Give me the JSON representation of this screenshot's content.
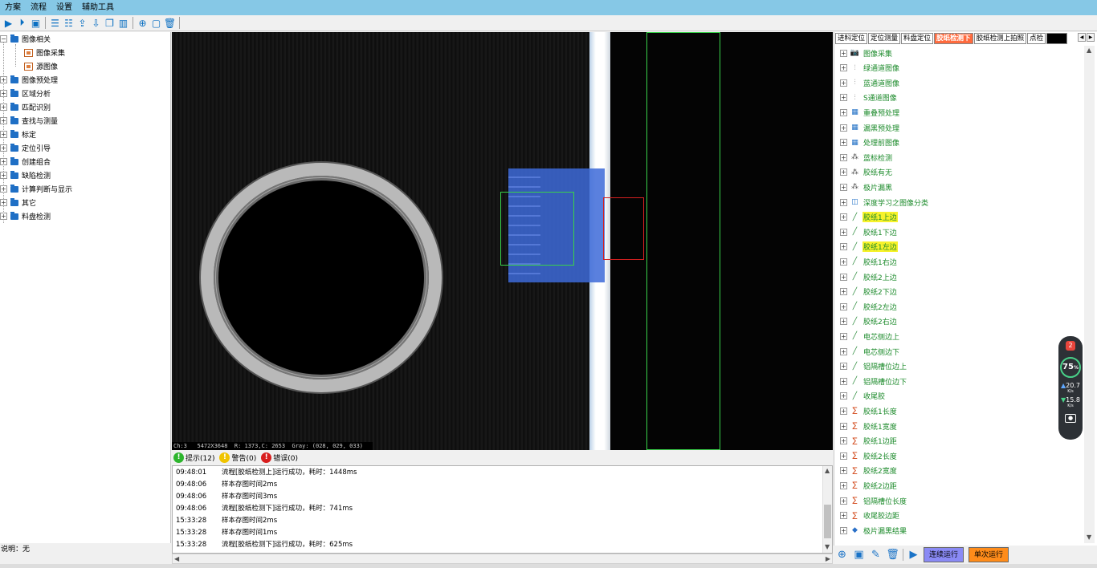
{
  "menu": [
    "方案",
    "流程",
    "设置",
    "辅助工具"
  ],
  "toolbar_icons": [
    "run-icon",
    "run-once-icon",
    "save-icon",
    "list-icon",
    "list-add-icon",
    "export-icon",
    "import-icon",
    "copy-icon",
    "chart-icon",
    "add-icon",
    "window-icon",
    "delete-icon"
  ],
  "left_tree": [
    {
      "label": "图像相关",
      "level": 0,
      "expanded": true
    },
    {
      "label": "图像采集",
      "level": 1
    },
    {
      "label": "源图像",
      "level": 1
    },
    {
      "label": "图像预处理",
      "level": 0
    },
    {
      "label": "区域分析",
      "level": 0
    },
    {
      "label": "匹配识别",
      "level": 0
    },
    {
      "label": "查找与测量",
      "level": 0
    },
    {
      "label": "标定",
      "level": 0
    },
    {
      "label": "定位引导",
      "level": 0
    },
    {
      "label": "创建组合",
      "level": 0
    },
    {
      "label": "缺陷检测",
      "level": 0
    },
    {
      "label": "计算判断与显示",
      "level": 0
    },
    {
      "label": "其它",
      "level": 0
    },
    {
      "label": "料盘检测",
      "level": 0
    }
  ],
  "description_label": "说明：无",
  "pixel_info": "Ch:3   5472X3648  R: 1373,C: 2653  Gray: (028, 029, 033)",
  "message_tabs": [
    {
      "label": "提示(12)",
      "color": "#2db52d"
    },
    {
      "label": "警告(0)",
      "color": "#f0c400"
    },
    {
      "label": "错误(0)",
      "color": "#d81e1e"
    }
  ],
  "log": [
    {
      "time": "09:48:01",
      "text": "流程[胶纸检测上]运行成功，耗时：1448ms"
    },
    {
      "time": "09:48:06",
      "text": "样本存图时间2ms"
    },
    {
      "time": "09:48:06",
      "text": "样本存图时间3ms"
    },
    {
      "time": "09:48:06",
      "text": "流程[胶纸检测下]运行成功，耗时：741ms"
    },
    {
      "time": "15:33:28",
      "text": "样本存图时间2ms"
    },
    {
      "time": "15:33:28",
      "text": "样本存图时间1ms"
    },
    {
      "time": "15:33:28",
      "text": "流程[胶纸检测下]运行成功，耗时：625ms"
    }
  ],
  "right_tabs": [
    {
      "label": "进料定位",
      "active": false
    },
    {
      "label": "定位测量",
      "active": false
    },
    {
      "label": "料盘定位",
      "active": false
    },
    {
      "label": "胶纸检测下",
      "active": true
    },
    {
      "label": "胶纸检测上拍照",
      "active": false
    },
    {
      "label": "点检",
      "active": false
    }
  ],
  "right_tree": [
    {
      "label": "图像采集",
      "icon": "camera-icon",
      "hl": false
    },
    {
      "label": "绿通道图像",
      "icon": "channel-icon",
      "hl": false
    },
    {
      "label": "蓝通道图像",
      "icon": "channel-icon",
      "hl": false
    },
    {
      "label": "S通道图像",
      "icon": "channel-icon",
      "hl": false
    },
    {
      "label": "重叠预处理",
      "icon": "preprocess-icon",
      "hl": false
    },
    {
      "label": "漏黑预处理",
      "icon": "preprocess-icon",
      "hl": false
    },
    {
      "label": "处理前图像",
      "icon": "preprocess-icon",
      "hl": false
    },
    {
      "label": "蓝标检测",
      "icon": "blob-icon",
      "hl": false
    },
    {
      "label": "胶纸有无",
      "icon": "blob-icon",
      "hl": false
    },
    {
      "label": "极片漏黑",
      "icon": "blob-icon",
      "hl": false
    },
    {
      "label": "深度学习之图像分类",
      "icon": "deep-learning-icon",
      "hl": false
    },
    {
      "label": "胶纸1上边",
      "icon": "line-icon",
      "hl": true
    },
    {
      "label": "胶纸1下边",
      "icon": "line-icon",
      "hl": false
    },
    {
      "label": "胶纸1左边",
      "icon": "line-icon",
      "hl": true
    },
    {
      "label": "胶纸1右边",
      "icon": "line-icon",
      "hl": false
    },
    {
      "label": "胶纸2上边",
      "icon": "line-icon",
      "hl": false
    },
    {
      "label": "胶纸2下边",
      "icon": "line-icon",
      "hl": false
    },
    {
      "label": "胶纸2左边",
      "icon": "line-icon",
      "hl": false
    },
    {
      "label": "胶纸2右边",
      "icon": "line-icon",
      "hl": false
    },
    {
      "label": "电芯侧边上",
      "icon": "line-icon",
      "hl": false
    },
    {
      "label": "电芯侧边下",
      "icon": "line-icon",
      "hl": false
    },
    {
      "label": "铝隔槽位边上",
      "icon": "line-icon",
      "hl": false
    },
    {
      "label": "铝隔槽位边下",
      "icon": "line-icon",
      "hl": false
    },
    {
      "label": "收尾胶",
      "icon": "line-icon",
      "hl": false
    },
    {
      "label": "胶纸1长度",
      "icon": "calc-icon",
      "hl": false
    },
    {
      "label": "胶纸1宽度",
      "icon": "calc-icon",
      "hl": false
    },
    {
      "label": "胶纸1边距",
      "icon": "calc-icon",
      "hl": false
    },
    {
      "label": "胶纸2长度",
      "icon": "calc-icon",
      "hl": false
    },
    {
      "label": "胶纸2宽度",
      "icon": "calc-icon",
      "hl": false
    },
    {
      "label": "胶纸2边距",
      "icon": "calc-icon",
      "hl": false
    },
    {
      "label": "铝隔槽位长度",
      "icon": "calc-icon",
      "hl": false
    },
    {
      "label": "收尾胶边距",
      "icon": "calc-icon",
      "hl": false
    },
    {
      "label": "极片漏黑结果",
      "icon": "result-icon",
      "hl": false
    }
  ],
  "buttons": {
    "continuous": "连续运行",
    "single": "单次运行"
  },
  "monitor": {
    "badge": "2",
    "percent": "75",
    "unit": "%",
    "up": "20.7",
    "up_unit": "K/s",
    "down": "15.8",
    "down_unit": "K/s"
  }
}
